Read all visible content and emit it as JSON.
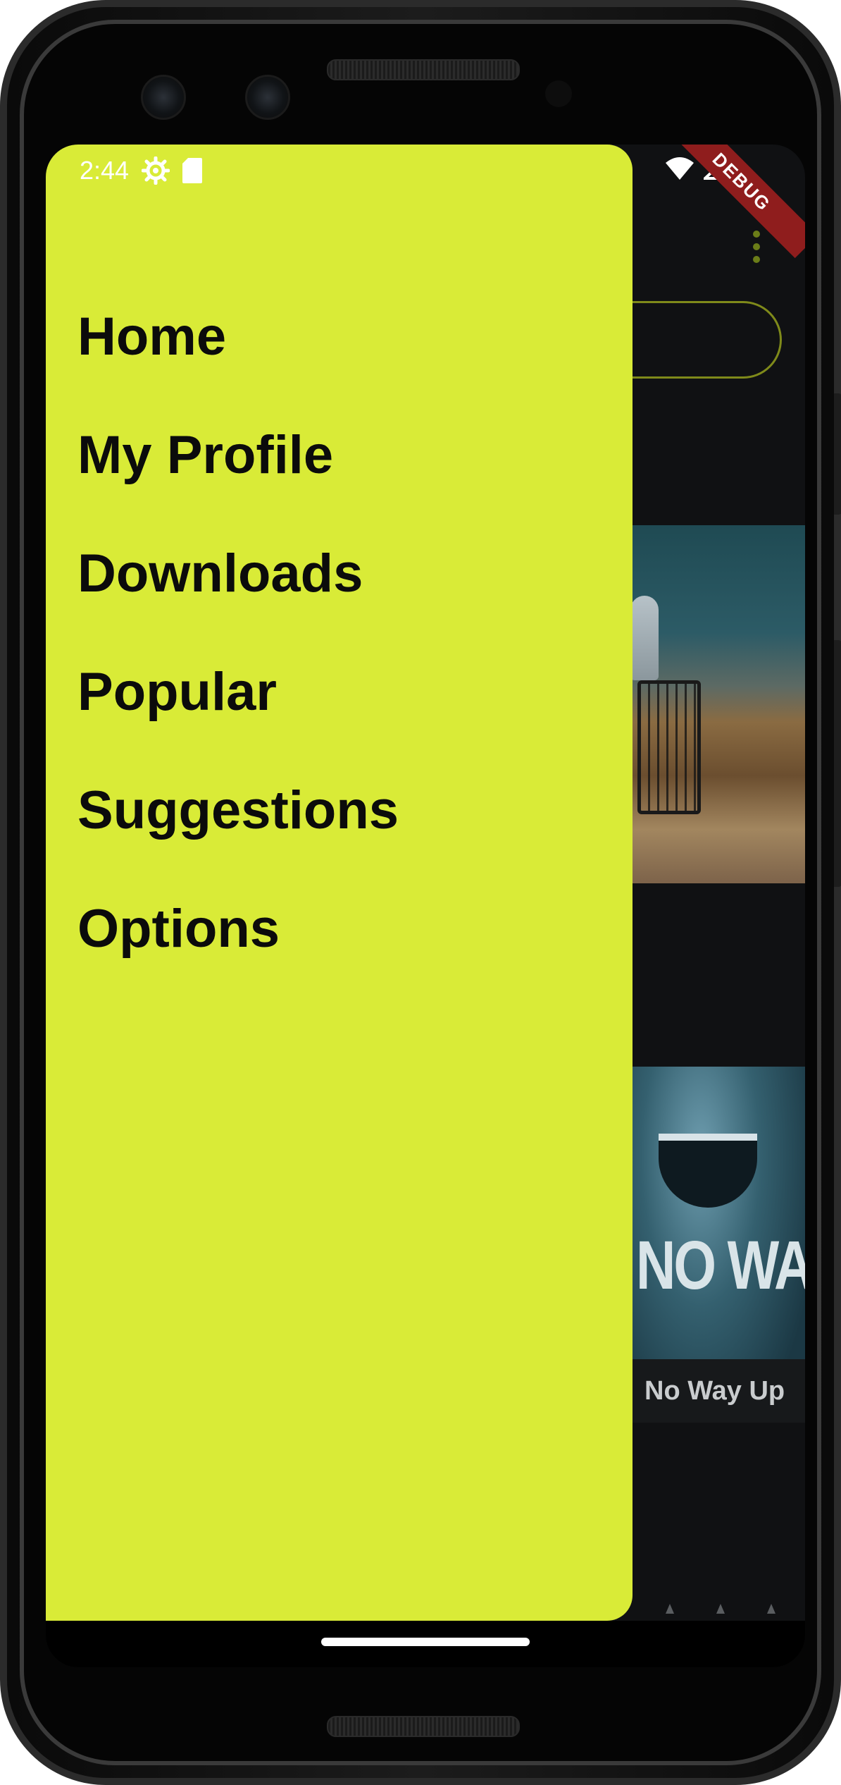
{
  "status_bar": {
    "time": "2:44",
    "debug_label": "DEBUG",
    "icons": [
      "settings-icon",
      "sd-card-icon",
      "wifi-icon",
      "signal-icon"
    ]
  },
  "drawer": {
    "background_color": "#d9eb37",
    "items": [
      {
        "label": "Home"
      },
      {
        "label": "My Profile"
      },
      {
        "label": "Downloads"
      },
      {
        "label": "Popular"
      },
      {
        "label": "Suggestions"
      },
      {
        "label": "Options"
      }
    ]
  },
  "background_app": {
    "accent_color": "#7f8a1a",
    "posters": [
      {
        "title_art": "NO WAY UP",
        "caption": "No Way Up"
      }
    ]
  }
}
